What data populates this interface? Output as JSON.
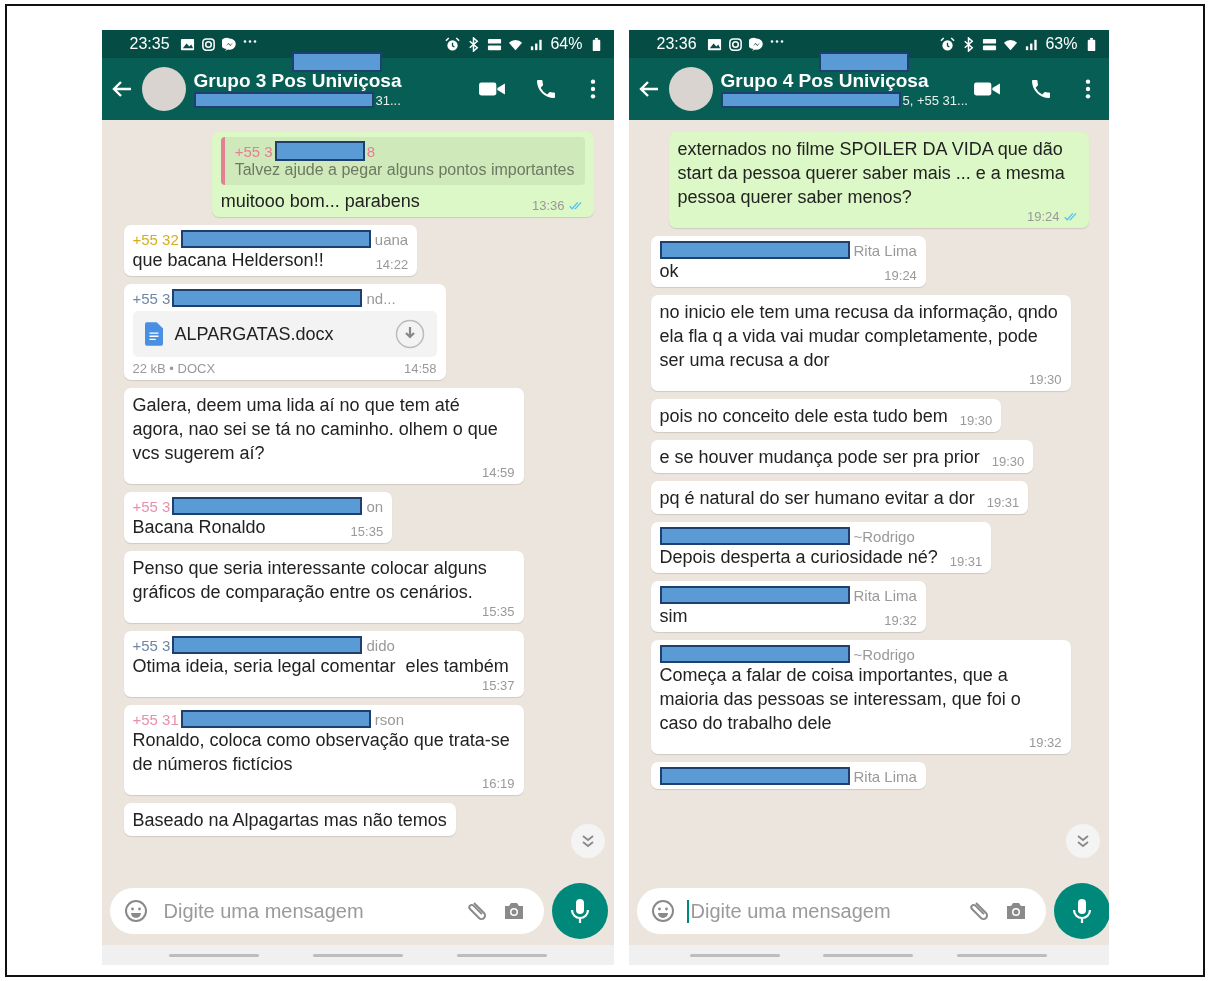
{
  "phones": [
    {
      "status": {
        "time": "23:35",
        "battery": "64%"
      },
      "header": {
        "title": "Grupo 3 Pos Univiçosa",
        "subtitle": "31..."
      },
      "messages": [
        {
          "kind": "quote",
          "outgoing": true,
          "quote": {
            "prefix": "+55 3",
            "suffix": "8",
            "color": "#e57f94",
            "text": "Talvez ajude a pegar alguns pontos importantes"
          },
          "text": "muitooo bom... parabens",
          "time": "13:36",
          "read": true
        },
        {
          "kind": "text",
          "outgoing": false,
          "sender": {
            "prefix": "+55 32",
            "suffix": "uana",
            "color": "#d4ae1e"
          },
          "text": "que bacana Helderson!!",
          "time": "14:22"
        },
        {
          "kind": "document",
          "outgoing": false,
          "sender": {
            "prefix": "+55 3",
            "suffix": "nd...",
            "color": "#6f87a3"
          },
          "file": "ALPARGATAS.docx",
          "meta": "22 kB • DOCX",
          "time": "14:58"
        },
        {
          "kind": "text",
          "outgoing": false,
          "text": "Galera, deem uma lida aí no que tem até agora, nao sei se tá no caminho. olhem o que vcs sugerem aí?",
          "time": "14:59"
        },
        {
          "kind": "text",
          "outgoing": false,
          "sender": {
            "prefix": "+55 3",
            "suffix": "on",
            "color": "#e88fb0"
          },
          "text": "Bacana Ronaldo",
          "time": "15:35"
        },
        {
          "kind": "text",
          "outgoing": false,
          "text": "Penso que seria interessante colocar alguns gráficos de comparação entre os cenários.",
          "time": "15:35"
        },
        {
          "kind": "text",
          "outgoing": false,
          "sender": {
            "prefix": "+55 3",
            "suffix": "dido",
            "color": "#6f87a3"
          },
          "text": "Otima ideia, seria legal comentar  eles também",
          "time": "15:37"
        },
        {
          "kind": "text",
          "outgoing": false,
          "sender": {
            "prefix": "+55 31",
            "suffix": "rson",
            "color": "#e88fb0"
          },
          "text": "Ronaldo, coloca como observação que trata-se de números fictícios",
          "time": "16:19"
        },
        {
          "kind": "text",
          "outgoing": false,
          "text": "Baseado na Alpagartas mas não temos"
        }
      ],
      "input": {
        "placeholder": "Digite uma mensagem",
        "focused": false
      }
    },
    {
      "status": {
        "time": "23:36",
        "battery": "63%"
      },
      "header": {
        "title": "Grupo 4 Pos Univiçosa",
        "subtitle": "5, +55 31..."
      },
      "messages": [
        {
          "kind": "text",
          "outgoing": true,
          "text": "externados no filme SPOILER DA VIDA que dão start da pessoa querer saber mais ... e a mesma pessoa querer saber menos?",
          "time": "19:24",
          "read": true
        },
        {
          "kind": "text",
          "outgoing": false,
          "sender": {
            "suffix": "Rita Lima"
          },
          "text": "ok",
          "time": "19:24"
        },
        {
          "kind": "text",
          "outgoing": false,
          "text": "no inicio ele tem uma recusa da informação, qndo ela fla q a vida vai mudar completamente, pode ser uma recusa a dor",
          "time": "19:30"
        },
        {
          "kind": "text",
          "outgoing": false,
          "text": "pois no conceito dele esta tudo bem",
          "time": "19:30"
        },
        {
          "kind": "text",
          "outgoing": false,
          "text": "e se houver mudança pode ser pra prior",
          "time": "19:30"
        },
        {
          "kind": "text",
          "outgoing": false,
          "text": "pq é natural do ser humano evitar a dor",
          "time": "19:31"
        },
        {
          "kind": "text",
          "outgoing": false,
          "sender": {
            "suffix": "~Rodrigo"
          },
          "text": "Depois desperta a curiosidade né?",
          "time": "19:31"
        },
        {
          "kind": "text",
          "outgoing": false,
          "sender": {
            "suffix": "Rita Lima"
          },
          "text": "sim",
          "time": "19:32"
        },
        {
          "kind": "text",
          "outgoing": false,
          "sender": {
            "suffix": "~Rodrigo"
          },
          "text": "Começa a falar de coisa importantes, que a maioria das pessoas se interessam, que foi o caso do trabalho dele",
          "time": "19:32"
        },
        {
          "kind": "text",
          "outgoing": false,
          "sender": {
            "suffix": "Rita Lima"
          }
        }
      ],
      "input": {
        "placeholder": "Digite uma mensagem",
        "focused": true
      }
    }
  ]
}
